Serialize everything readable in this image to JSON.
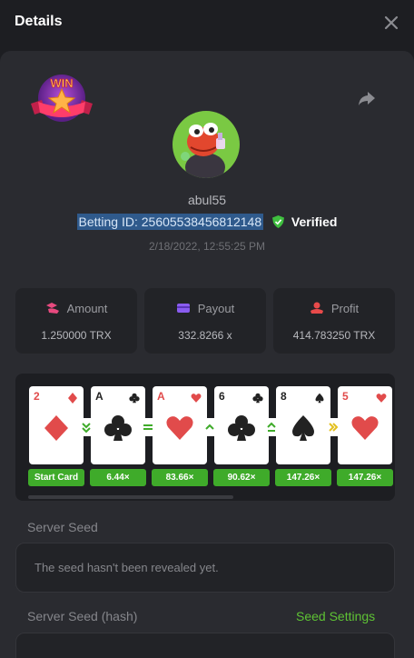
{
  "header": {
    "title": "Details"
  },
  "badge": {
    "text": "WIN"
  },
  "player": {
    "username": "abul55",
    "betting_id_label": "Betting ID: 25605538456812148",
    "verified_label": "Verified",
    "datetime": "2/18/2022, 12:55:25 PM"
  },
  "stats": {
    "amount": {
      "label": "Amount",
      "value": "1.250000 TRX"
    },
    "payout": {
      "label": "Payout",
      "value": "332.8266 x"
    },
    "profit": {
      "label": "Profit",
      "value": "414.783250 TRX"
    }
  },
  "game": {
    "cards": [
      {
        "rank": "2",
        "suit": "diamond",
        "color": "#e14b4b"
      },
      {
        "rank": "A",
        "suit": "club",
        "color": "#222222"
      },
      {
        "rank": "A",
        "suit": "heart",
        "color": "#e14b4b"
      },
      {
        "rank": "6",
        "suit": "club",
        "color": "#222222"
      },
      {
        "rank": "8",
        "suit": "spade",
        "color": "#222222"
      },
      {
        "rank": "5",
        "suit": "heart",
        "color": "#e14b4b"
      }
    ],
    "steps": [
      "lower",
      "equal",
      "higher",
      "higher-or-equal",
      "skip"
    ],
    "multipliers": [
      "Start Card",
      "6.44×",
      "83.66×",
      "90.62×",
      "147.26×",
      "147.26×"
    ]
  },
  "server_seed": {
    "label": "Server Seed",
    "placeholder": "The seed hasn't been revealed yet."
  },
  "server_seed_hash": {
    "label": "Server Seed (hash)",
    "link": "Seed Settings"
  },
  "colors": {
    "accent": "#5ec234",
    "multiplier_bg": "#3fab2a",
    "selection": "#2f5a8c"
  }
}
